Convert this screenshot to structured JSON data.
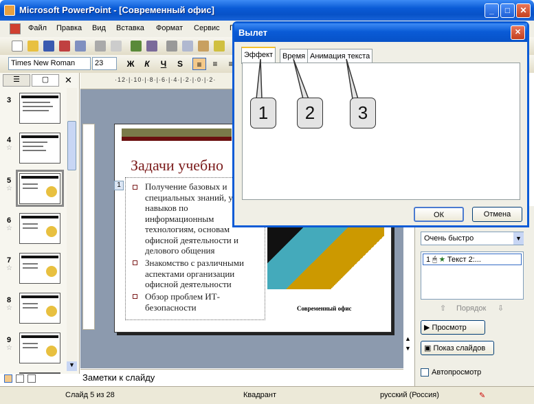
{
  "app": {
    "title": "Microsoft PowerPoint - [Современный офис]"
  },
  "menu": [
    "Файл",
    "Правка",
    "Вид",
    "Вставка",
    "Формат",
    "Сервис",
    "П"
  ],
  "toolbar": {
    "font": "Times New Roman",
    "size": "23",
    "bold": "Ж",
    "italic": "К",
    "underline": "Ч",
    "shadow": "S"
  },
  "ruler": {
    "h": "·12·|·10·|·8·|·6·|·4·|·2·|·0·|·2·"
  },
  "thumbs": [
    {
      "num": "3"
    },
    {
      "num": "4",
      "star": "☆"
    },
    {
      "num": "5",
      "star": "☆"
    },
    {
      "num": "6",
      "star": "☆"
    },
    {
      "num": "7",
      "star": "☆"
    },
    {
      "num": "8",
      "star": "☆"
    },
    {
      "num": "9",
      "star": "☆"
    }
  ],
  "slide": {
    "title": "Задачи учебно",
    "marker": "1",
    "bullets": [
      "Получение базовых и специальных знаний, у и навыков по информационным технологиям, основам офисной деятельности и делового общения",
      "Знакомство с различными аспектами организации офисной деятельности",
      "Обзор проблем ИТ-безопасности"
    ],
    "caption": "Современный офис"
  },
  "notes": {
    "text": "Заметки к слайду"
  },
  "status": {
    "slide": "Слайд 5 из 28",
    "design": "Квадрант",
    "lang": "русский (Россия)"
  },
  "taskpane": {
    "speed": "Очень быстро",
    "list_num": "1",
    "list_item": "Текст 2:...",
    "order": "Порядок",
    "preview": "Просмотр",
    "slideshow": "Показ слайдов",
    "autopreview": "Автопросмотр"
  },
  "dialog": {
    "title": "Вылет",
    "tabs": [
      "Эффект",
      "Время",
      "Анимация текста"
    ],
    "callouts": [
      "1",
      "2",
      "3"
    ],
    "ok": "ОК",
    "cancel": "Отмена"
  },
  "colors": {
    "accent": "#0a5bd6",
    "title_red": "#7a1a1a"
  }
}
